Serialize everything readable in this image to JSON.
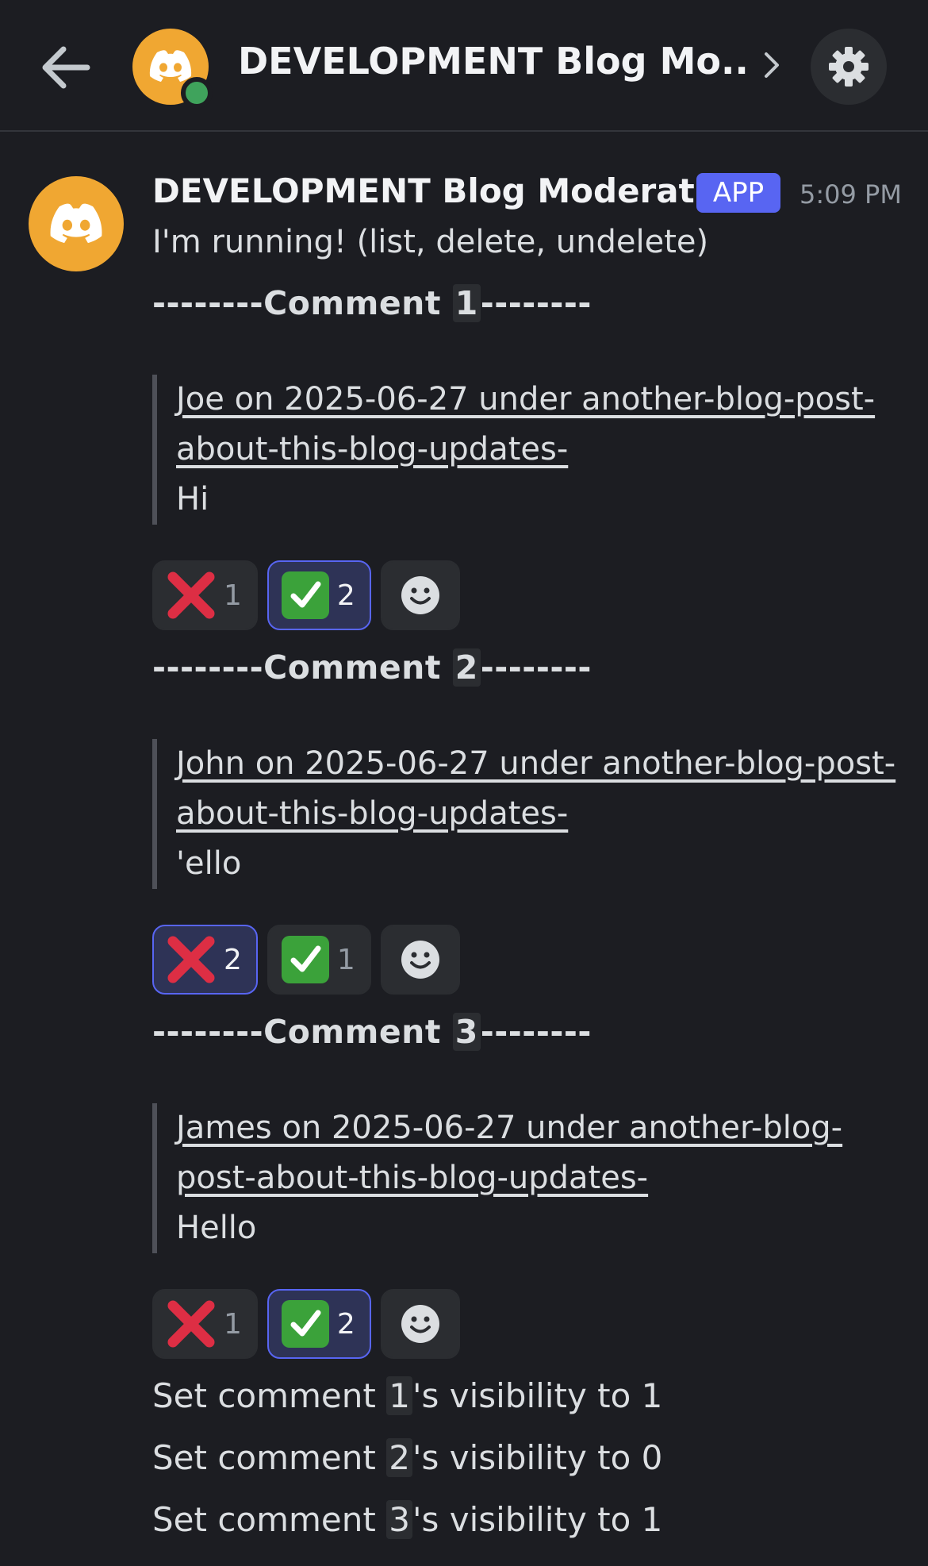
{
  "header": {
    "title": "DEVELOPMENT Blog Mo..."
  },
  "message": {
    "author": "DEVELOPMENT Blog Moderat...",
    "badge": "APP",
    "timestamp": "5:09 PM",
    "status_text": "I'm running! (list, delete, undelete)",
    "comments": [
      {
        "dashes": "--------",
        "label": "Comment ",
        "number": "1",
        "quote_link": "Joe on 2025-06-27 under another-blog-post-about-this-blog-updates-",
        "body": "Hi",
        "reactions": [
          {
            "emoji": "cross-mark",
            "count": "1",
            "selected": false
          },
          {
            "emoji": "check-mark",
            "count": "2",
            "selected": true
          }
        ]
      },
      {
        "dashes": "--------",
        "label": "Comment ",
        "number": "2",
        "quote_link": "John on 2025-06-27 under another-blog-post-about-this-blog-updates-",
        "body": "'ello",
        "reactions": [
          {
            "emoji": "cross-mark",
            "count": "2",
            "selected": true
          },
          {
            "emoji": "check-mark",
            "count": "1",
            "selected": false
          }
        ]
      },
      {
        "dashes": "--------",
        "label": "Comment ",
        "number": "3",
        "quote_link": "James on 2025-06-27 under another-blog-post-about-this-blog-updates-",
        "body": "Hello",
        "reactions": [
          {
            "emoji": "cross-mark",
            "count": "1",
            "selected": false
          },
          {
            "emoji": "check-mark",
            "count": "2",
            "selected": true
          }
        ]
      }
    ],
    "visibility_updates": [
      {
        "prefix": "Set comment ",
        "number": "1",
        "suffix": "'s visibility to 1"
      },
      {
        "prefix": "Set comment ",
        "number": "2",
        "suffix": "'s visibility to 0"
      },
      {
        "prefix": "Set comment ",
        "number": "3",
        "suffix": "'s visibility to 1"
      }
    ]
  },
  "colors": {
    "background": "#1c1d22",
    "accent": "#5865f2",
    "avatar": "#f0a732",
    "online": "#3fa35c"
  }
}
